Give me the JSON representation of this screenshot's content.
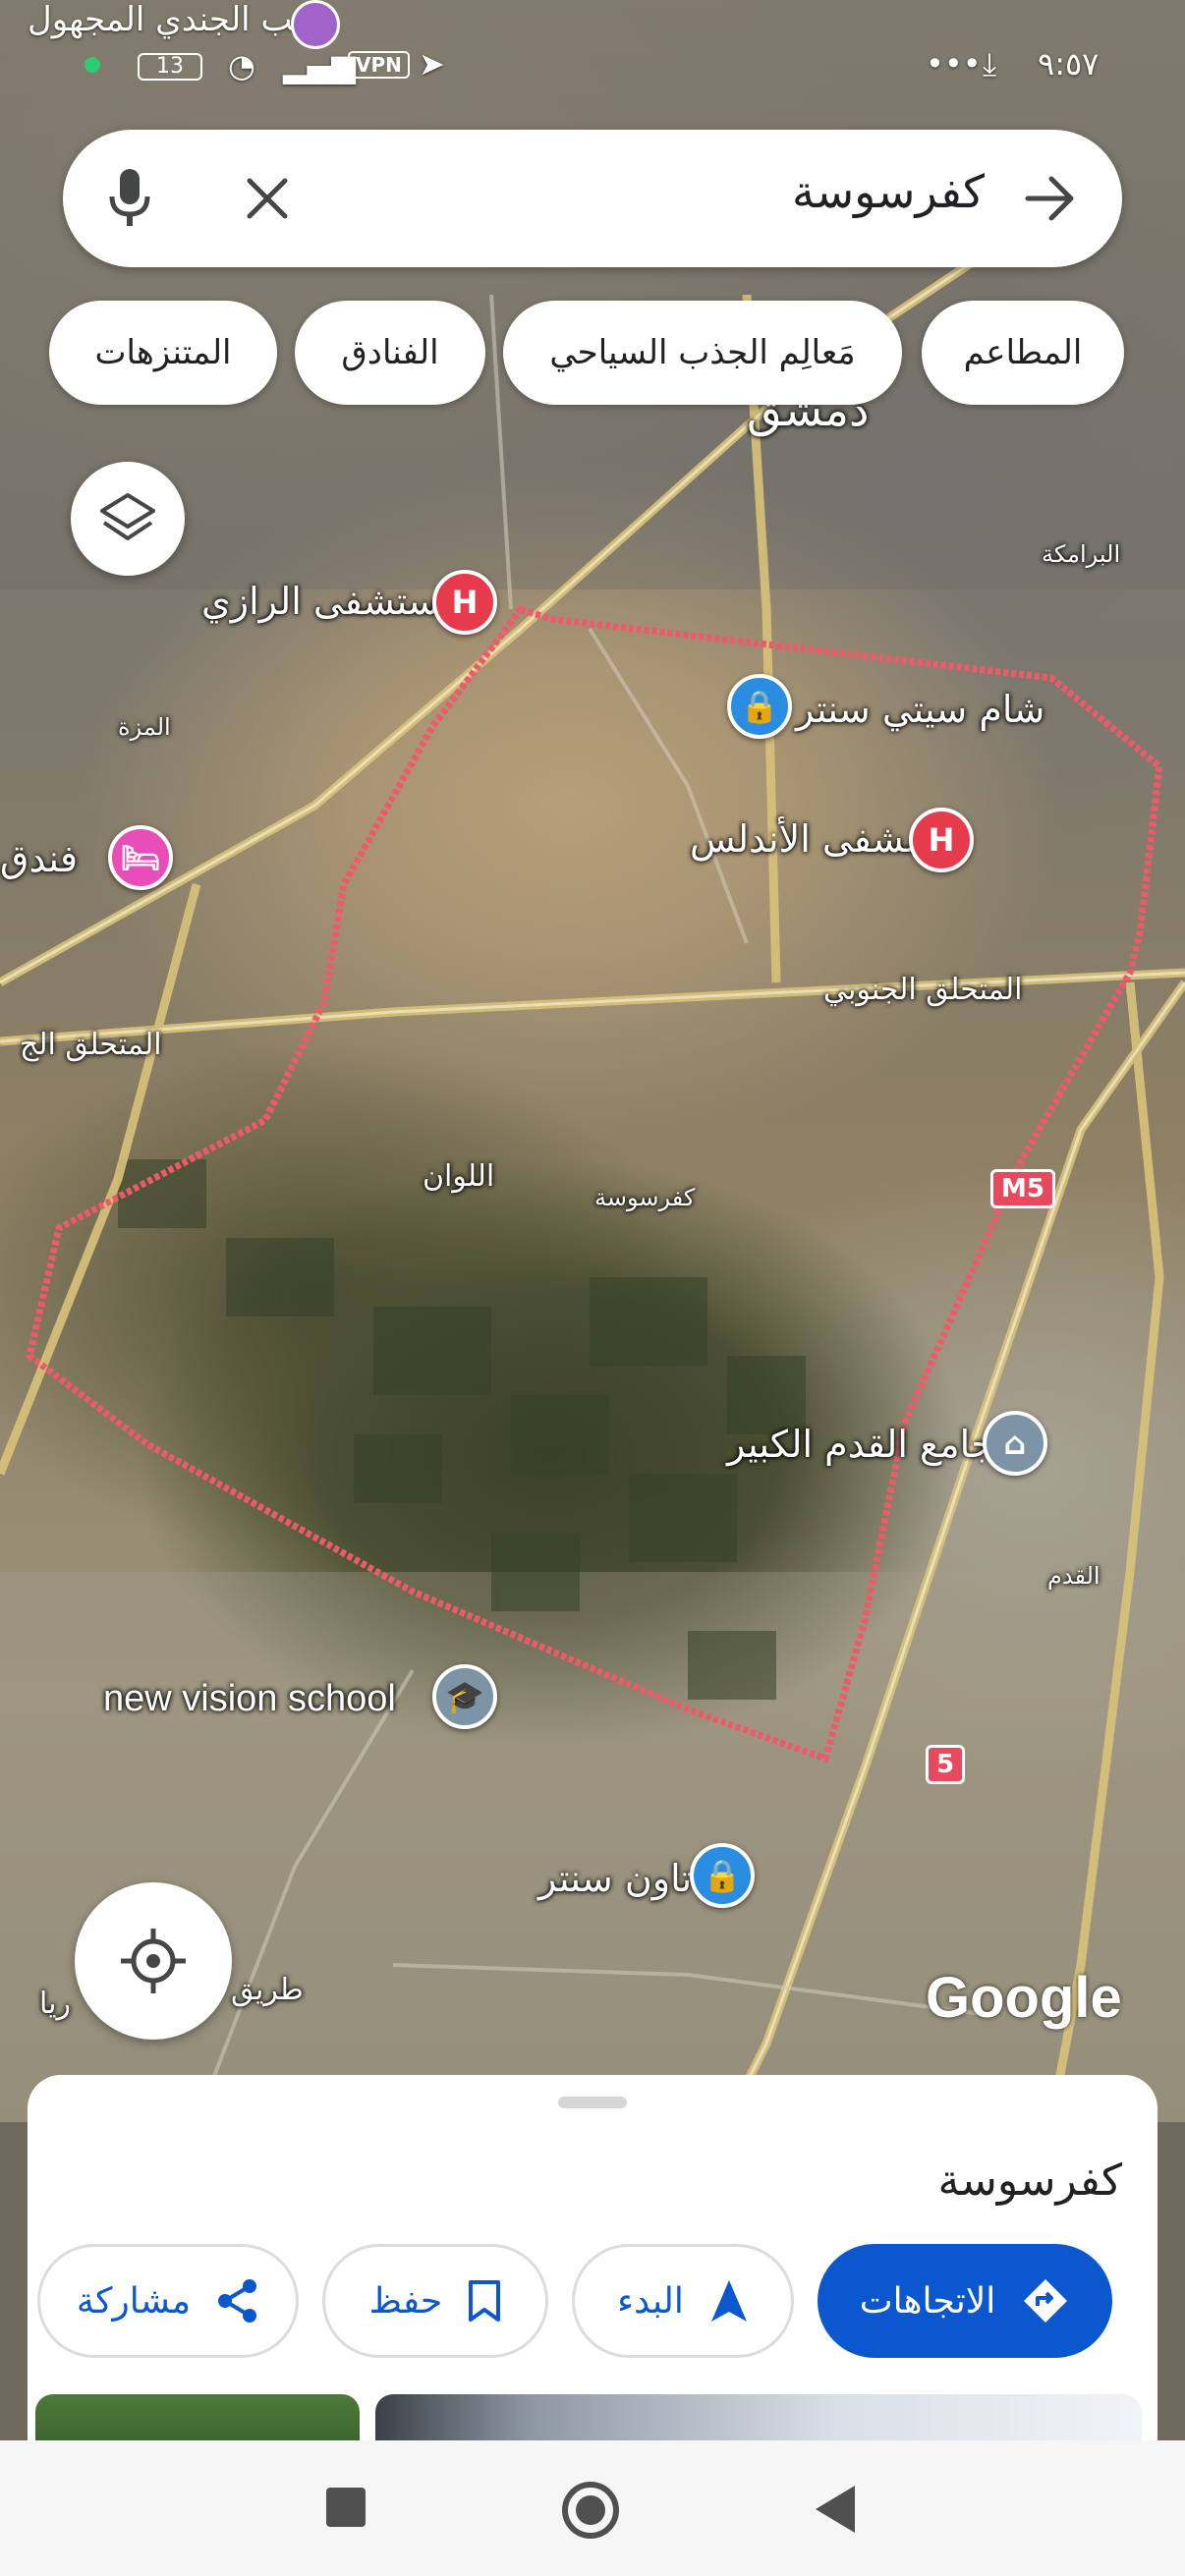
{
  "status_bar": {
    "time": "٩:٥٧",
    "battery": "13",
    "vpn": "VPN",
    "top_place_label": "نصب الجندي المجهول"
  },
  "search": {
    "query": "كفرسوسة"
  },
  "chips": [
    {
      "label": "المطاعم"
    },
    {
      "label": "مَعالِم الجذب السياحي"
    },
    {
      "label": "الفنادق"
    },
    {
      "label": "المتنزهات"
    }
  ],
  "map": {
    "labels": {
      "razi_hospital": "مستشفى الرازي",
      "sham_city_center": "شام سيتي سنتر",
      "andalus_hospital": "مشفى الأندلس",
      "mezzeh": "المزة",
      "hotel": "فندق",
      "southern_ring": "المتحلق الجنوبي",
      "southern_ring_left": "المتحلق الج",
      "allawan": "اللوان",
      "kafrsouseh": "كفرسوسة",
      "qadam_mosque": "جامع القدم الكبير",
      "qadam": "القدم",
      "new_vision_school": "new vision school",
      "town_center": "تاون سنتر",
      "baramkeh": "البرامكة",
      "damascus": "دمشق",
      "road_bottom": "طريق",
      "road_bottom2": "ريا"
    },
    "shields": {
      "m5": "M5",
      "r5": "5"
    },
    "google_logo": "Google"
  },
  "sheet": {
    "title": "كفرسوسة",
    "buttons": {
      "directions": "الاتجاهات",
      "start": "البدء",
      "save": "حفظ",
      "share": "مشاركة"
    }
  },
  "colors": {
    "primary_blue": "#0b57d0",
    "hospital_red": "#e53b4d",
    "shopping_blue": "#2a8de1",
    "boundary": "#ef5a6a"
  },
  "icons": [
    "mic-icon",
    "close-icon",
    "arrow-forward-icon",
    "layers-icon",
    "my-location-icon",
    "directions-icon",
    "navigation-icon",
    "bookmark-icon",
    "share-icon"
  ]
}
